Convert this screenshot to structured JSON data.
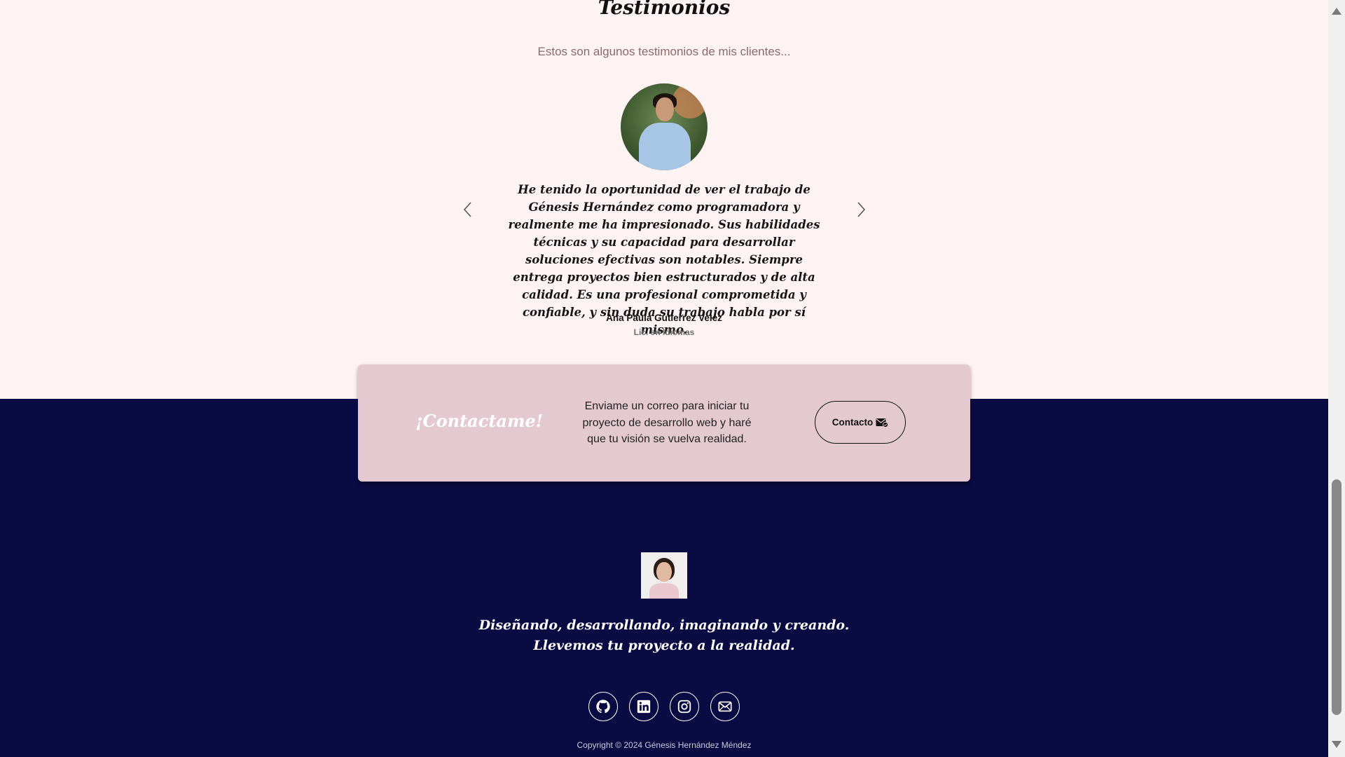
{
  "testimonials": {
    "title": "Testimonios",
    "subtitle": "Estos son algunos testimonios de mis clientes...",
    "quote": "He tenido la oportunidad de ver el trabajo de Génesis Hernández como programadora y realmente me ha impresionado. Sus habilidades técnicas y su capacidad para desarrollar soluciones efectivas son notables. Siempre entrega proyectos bien estructurados y de alta calidad. Es una profesional comprometida y confiable, y sin duda su trabajo habla por sí mismo.",
    "author": "Ana Paula Gutierrez Velez",
    "role": "Lic. en Idiomas",
    "prev_icon": "chevron-left-icon",
    "next_icon": "chevron-right-icon"
  },
  "contact": {
    "title": "¡Contactame!",
    "text": "Enviame un correo para iniciar tu proyecto de desarrollo web y haré que tu visión se vuelva realidad.",
    "button_label": "Contacto",
    "button_icon": "mail-check-icon"
  },
  "footer": {
    "tagline_line1": "Diseñando, desarrollando, imaginando y creando.",
    "tagline_line2": "Llevemos tu proyecto a la realidad.",
    "socials": [
      "github-icon",
      "linkedin-icon",
      "instagram-icon",
      "envelope-icon"
    ],
    "copyright": "Copyright © 2024 Génesis Hernández Méndez"
  },
  "colors": {
    "page_bg": "#fdf3f3",
    "footer_bg": "#0b0b44",
    "card_bg": "#e4c9d1",
    "subtitle": "#8a6a6a"
  }
}
